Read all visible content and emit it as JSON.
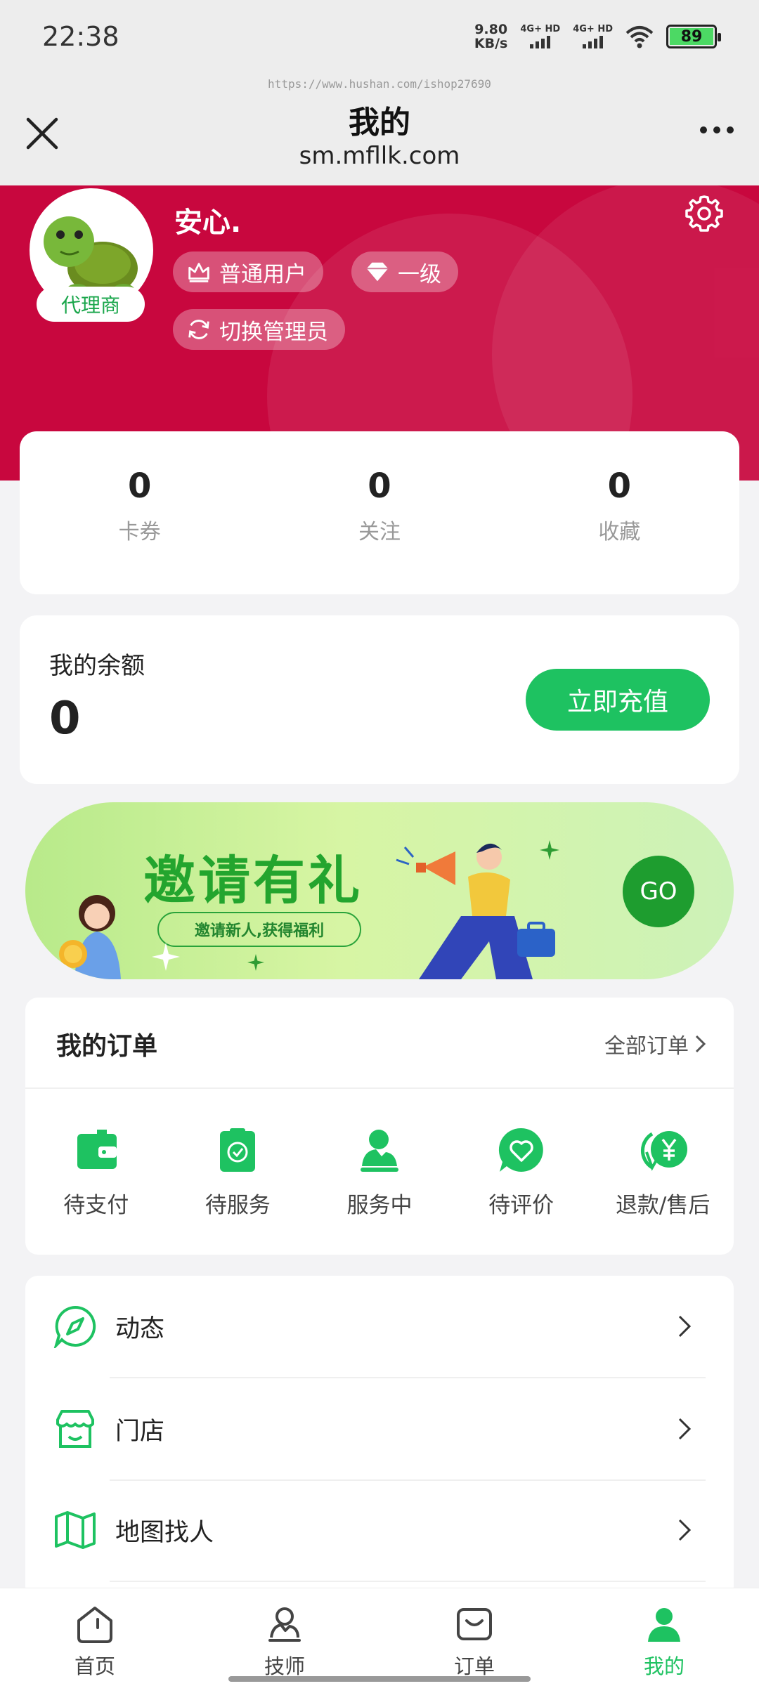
{
  "status_bar": {
    "time": "22:38",
    "speed_value": "9.80",
    "speed_unit": "KB/s",
    "sim1_label": "4G+ HD",
    "sim2_label": "4G+ HD",
    "battery": "89"
  },
  "header": {
    "watermark": "https://www.hushan.com/ishop27690",
    "title": "我的",
    "subtitle": "sm.mfllk.com",
    "icons": {
      "close": "close-icon",
      "more": "more-icon"
    }
  },
  "profile": {
    "username": "安心.",
    "agent_badge": "代理商",
    "tags": [
      "普通用户",
      "一级"
    ],
    "switch_label": "切换管理员",
    "accent": "#c8073e"
  },
  "stats": [
    {
      "value": "0",
      "label": "卡券"
    },
    {
      "value": "0",
      "label": "关注"
    },
    {
      "value": "0",
      "label": "收藏"
    }
  ],
  "balance": {
    "label": "我的余额",
    "value": "0",
    "recharge_label": "立即充值"
  },
  "invite_banner": {
    "title": "邀请有礼",
    "subtitle": "邀请新人,获得福利",
    "go_label": "GO"
  },
  "orders": {
    "title": "我的订单",
    "all_label": "全部订单",
    "items": [
      {
        "label": "待支付",
        "icon": "wallet-icon"
      },
      {
        "label": "待服务",
        "icon": "clipboard-check-icon"
      },
      {
        "label": "服务中",
        "icon": "technician-icon"
      },
      {
        "label": "待评价",
        "icon": "heart-chat-icon"
      },
      {
        "label": "退款/售后",
        "icon": "refund-yen-icon"
      }
    ]
  },
  "menu": [
    {
      "label": "动态",
      "icon": "compass-icon"
    },
    {
      "label": "门店",
      "icon": "store-icon"
    },
    {
      "label": "地图找人",
      "icon": "map-icon"
    }
  ],
  "bottom_nav": [
    {
      "label": "首页",
      "icon": "home-icon",
      "active": false
    },
    {
      "label": "技师",
      "icon": "technician-icon",
      "active": false
    },
    {
      "label": "订单",
      "icon": "order-icon",
      "active": false
    },
    {
      "label": "我的",
      "icon": "user-icon",
      "active": true
    }
  ],
  "colors": {
    "brand_green": "#1ec261",
    "hero_red": "#c8073e"
  }
}
